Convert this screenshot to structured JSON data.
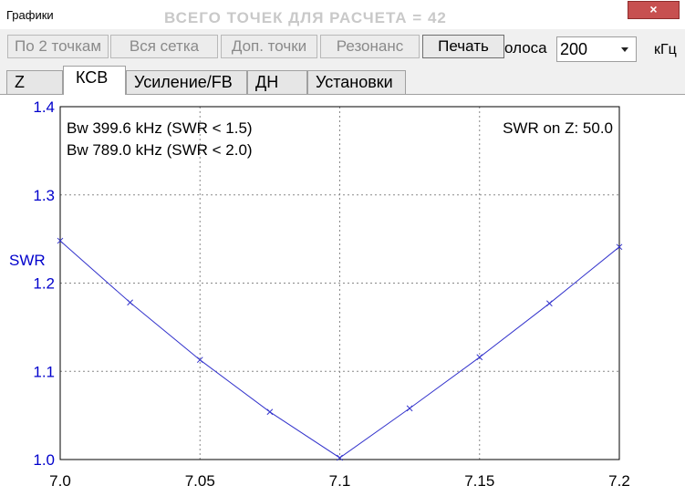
{
  "window": {
    "title": "Графики",
    "ghost_title": "ВСЕГО ТОЧЕК ДЛЯ РАСЧЕТА = 42",
    "close_symbol": "×"
  },
  "toolbar": {
    "buttons": [
      "По 2 точкам",
      "Вся сетка",
      "Доп. точки",
      "Резонанс",
      "Печать"
    ],
    "band_label": "олоса",
    "band_value": "200",
    "band_unit": "кГц"
  },
  "tabs": [
    "Z",
    "КСВ",
    "Усиление/FB",
    "ДН",
    "Установки"
  ],
  "selected_tab": "КСВ",
  "colors": {
    "axis_labels": "#0000cc",
    "curve": "#3333cc",
    "grid": "#888888"
  },
  "chart_data": {
    "type": "line",
    "ylabel": "SWR",
    "xlabel": "",
    "xlim": [
      7.0,
      7.2
    ],
    "ylim": [
      1.0,
      1.4
    ],
    "x_ticks": [
      "7.0",
      "7.05",
      "7.1",
      "7.15",
      "7.2"
    ],
    "y_ticks": [
      "1.0",
      "1.1",
      "1.2",
      "1.3",
      "1.4"
    ],
    "annotations": {
      "bw15": "Bw 399.6 kHz (SWR < 1.5)",
      "bw20": "Bw 789.0 kHz (SWR < 2.0)",
      "z": "SWR on Z: 50.0"
    },
    "series": [
      {
        "x": [
          7.0,
          7.025,
          7.05,
          7.075,
          7.1,
          7.125,
          7.15,
          7.175,
          7.2
        ],
        "y": [
          1.248,
          1.178,
          1.113,
          1.054,
          1.002,
          1.058,
          1.116,
          1.177,
          1.241
        ]
      }
    ]
  }
}
